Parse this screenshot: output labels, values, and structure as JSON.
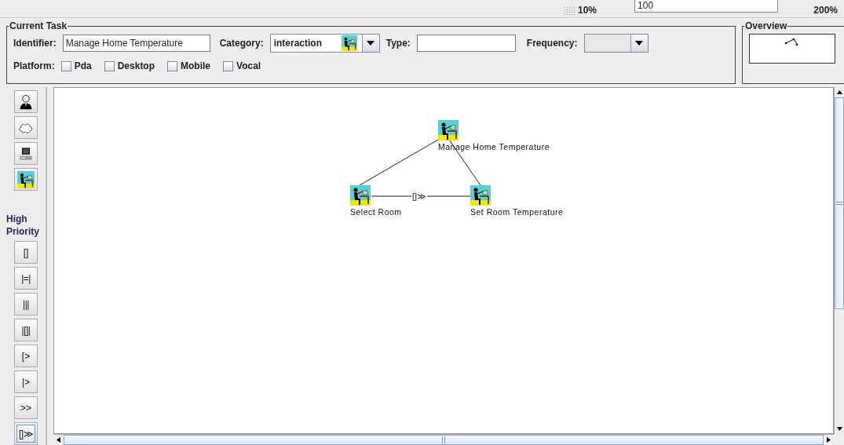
{
  "zoom": {
    "min_label": "10%",
    "value": "100",
    "max_label": "200%"
  },
  "current_task": {
    "title": "Current Task",
    "identifier": {
      "label": "Identifier:",
      "value": "Manage Home Temperature"
    },
    "category": {
      "label": "Category:",
      "value": "interaction"
    },
    "type": {
      "label": "Type:"
    },
    "frequency": {
      "label": "Frequency:"
    },
    "platform": {
      "label": "Platform:",
      "options": [
        {
          "label": "Pda",
          "checked": false
        },
        {
          "label": "Desktop",
          "checked": false
        },
        {
          "label": "Mobile",
          "checked": false
        },
        {
          "label": "Vocal",
          "checked": false
        }
      ]
    }
  },
  "overview": {
    "title": "Overview"
  },
  "task_types": [
    {
      "kind": "user"
    },
    {
      "kind": "abstraction"
    },
    {
      "kind": "application"
    },
    {
      "kind": "interaction"
    }
  ],
  "priority_label": "High Priority",
  "operators": [
    {
      "label": "[]",
      "selected": false
    },
    {
      "label": "|=|",
      "selected": false
    },
    {
      "label": "|||",
      "selected": false
    },
    {
      "label": "|[]|",
      "selected": false
    },
    {
      "label": "[>",
      "selected": false
    },
    {
      "label": "|>",
      "selected": false
    },
    {
      "label": ">>",
      "selected": false
    },
    {
      "label": "[]≫",
      "selected": true
    }
  ],
  "task_tree": {
    "label": "Manage Home Temperature",
    "kind": "interaction",
    "children": [
      {
        "label": "Select Room",
        "kind": "interaction"
      },
      {
        "label": "Set Room Temperature",
        "kind": "interaction"
      }
    ],
    "child_operators": [
      "[]≫"
    ]
  }
}
